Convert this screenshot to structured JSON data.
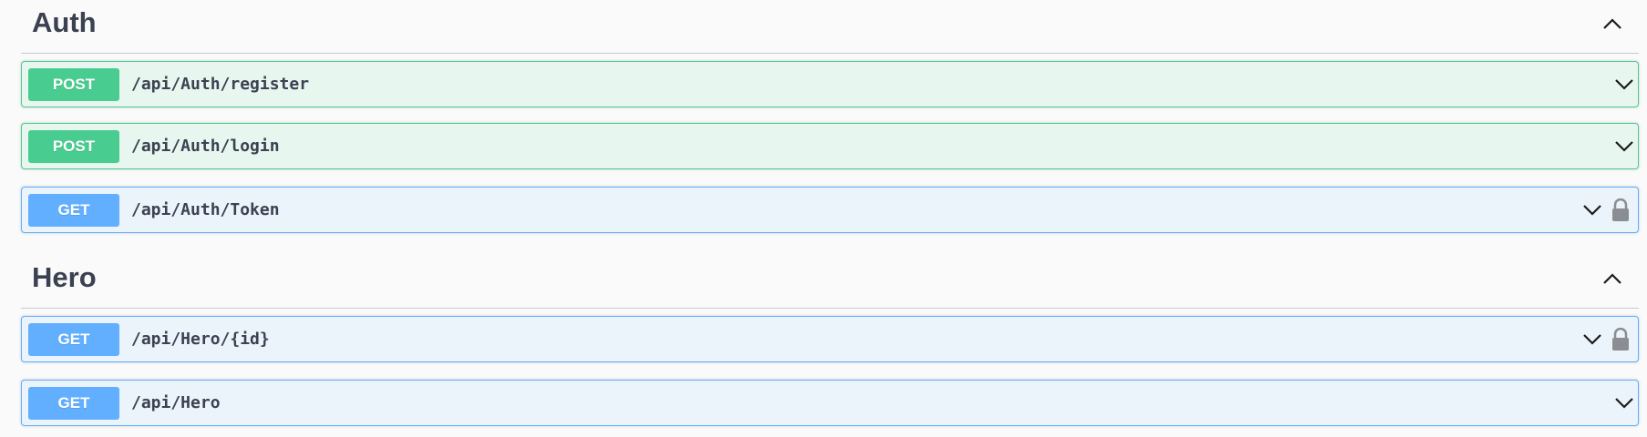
{
  "sections": {
    "auth": {
      "title": "Auth",
      "operations": [
        {
          "method": "POST",
          "path": "/api/Auth/register",
          "locked": false
        },
        {
          "method": "POST",
          "path": "/api/Auth/login",
          "locked": false
        },
        {
          "method": "GET",
          "path": "/api/Auth/Token",
          "locked": true
        }
      ]
    },
    "hero": {
      "title": "Hero",
      "operations": [
        {
          "method": "GET",
          "path": "/api/Hero/{id}",
          "locked": true
        },
        {
          "method": "GET",
          "path": "/api/Hero",
          "locked": false
        }
      ]
    }
  },
  "icons": {
    "collapse": "chevron-up-icon",
    "expand": "chevron-down-icon",
    "authorize": "lock-icon"
  },
  "colors": {
    "post": "#49cc90",
    "post_bg": "#e8f6f0",
    "get": "#61affe",
    "get_bg": "#ebf3fb",
    "text": "#3b4151"
  }
}
